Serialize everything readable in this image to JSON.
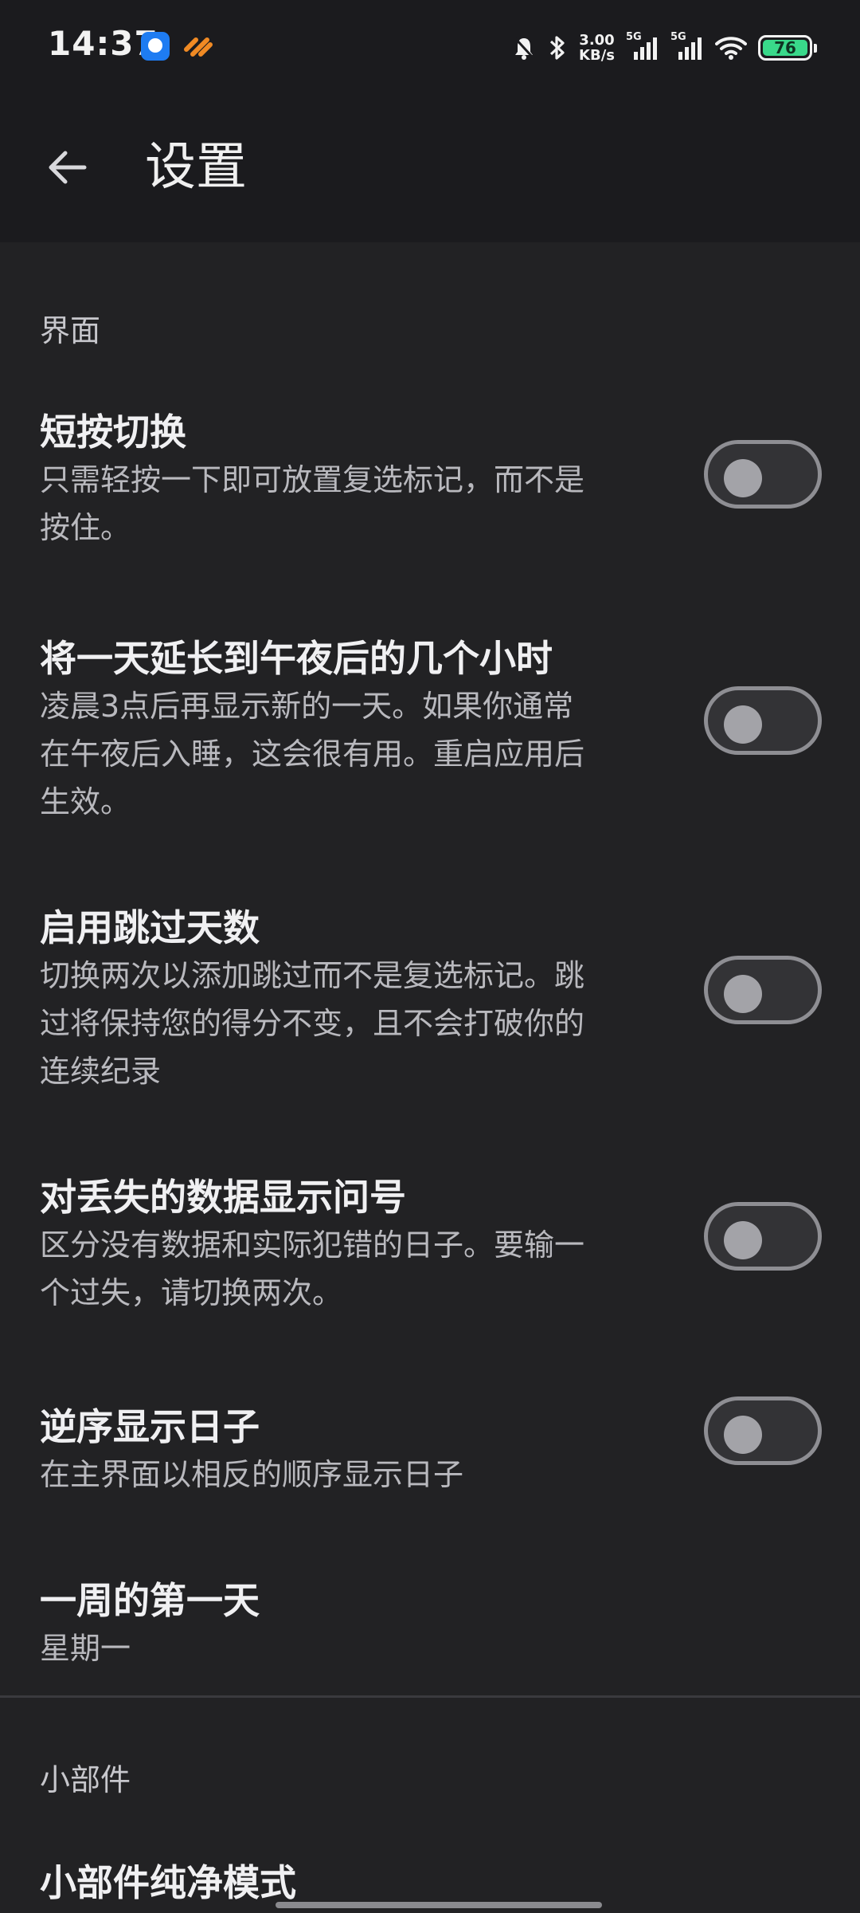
{
  "status_bar": {
    "time": "14:37",
    "net_speed_value": "3.00",
    "net_speed_unit": "KB/s",
    "signal1_label": "5G",
    "signal2_label": "5G",
    "battery": "76",
    "icons": [
      "app-blue-icon",
      "app-orange-icon",
      "alarm-off-icon",
      "bluetooth-icon",
      "signal-icon",
      "wifi-icon",
      "battery-icon"
    ]
  },
  "app_bar": {
    "title": "设置",
    "back_icon": "arrow-left-icon"
  },
  "sections": {
    "interface": {
      "title": "界面",
      "items": [
        {
          "title": "短按切换",
          "desc_lines": [
            "只需轻按一下即可放置复选标记，而不是",
            "按住。"
          ],
          "toggle_on": false
        },
        {
          "title": "将一天延长到午夜后的几个小时",
          "desc_lines": [
            "凌晨3点后再显示新的一天。如果你通常",
            "在午夜后入睡，这会很有用。重启应用后",
            "生效。"
          ],
          "toggle_on": false
        },
        {
          "title": "启用跳过天数",
          "desc_lines": [
            "切换两次以添加跳过而不是复选标记。跳",
            "过将保持您的得分不变，且不会打破你的",
            "连续纪录"
          ],
          "toggle_on": false
        },
        {
          "title": "对丢失的数据显示问号",
          "desc_lines": [
            "区分没有数据和实际犯错的日子。要输一",
            "个过失，请切换两次。"
          ],
          "toggle_on": false
        },
        {
          "title": "逆序显示日子",
          "desc_lines": [
            "在主界面以相反的顺序显示日子"
          ],
          "toggle_on": false
        },
        {
          "title": "一周的第一天",
          "value": "星期一"
        }
      ]
    },
    "widgets": {
      "title": "小部件",
      "items": [
        {
          "title": "小部件纯净模式"
        }
      ]
    }
  },
  "colors": {
    "background": "#222224",
    "top_bar": "#1b1b1e",
    "toggle_border": "#8e8e93",
    "toggle_knob": "#a3a3a8",
    "battery_fill": "#39d98a"
  }
}
